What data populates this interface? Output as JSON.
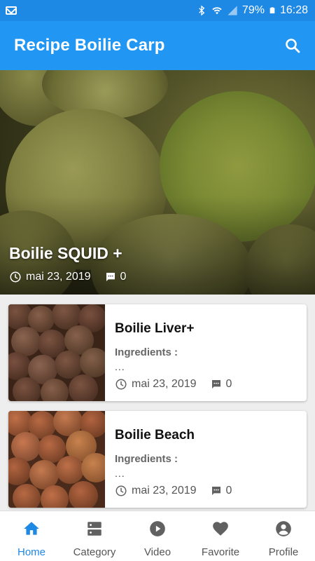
{
  "status_bar": {
    "battery": "79%",
    "time": "16:28"
  },
  "app_bar": {
    "title": "Recipe Boilie Carp"
  },
  "featured": {
    "title": "Boilie SQUID +",
    "date": "mai 23, 2019",
    "comments": "0"
  },
  "recipes": [
    {
      "title": "Boilie Liver+",
      "subtitle": "Ingredients :",
      "excerpt": "...",
      "date": "mai 23, 2019",
      "comments": "0"
    },
    {
      "title": "Boilie Beach",
      "subtitle": "Ingredients :",
      "excerpt": "...",
      "date": "mai 23, 2019",
      "comments": "0"
    }
  ],
  "bottom_nav": {
    "items": [
      {
        "label": "Home",
        "icon": "home-icon",
        "active": true
      },
      {
        "label": "Category",
        "icon": "category-icon",
        "active": false
      },
      {
        "label": "Video",
        "icon": "play-circle-icon",
        "active": false
      },
      {
        "label": "Favorite",
        "icon": "heart-icon",
        "active": false
      },
      {
        "label": "Profile",
        "icon": "account-circle-icon",
        "active": false
      }
    ]
  },
  "colors": {
    "status_bar": "#1e88e5",
    "app_bar": "#2196f3",
    "accent": "#1e88e5",
    "inactive_icon": "#616161"
  }
}
